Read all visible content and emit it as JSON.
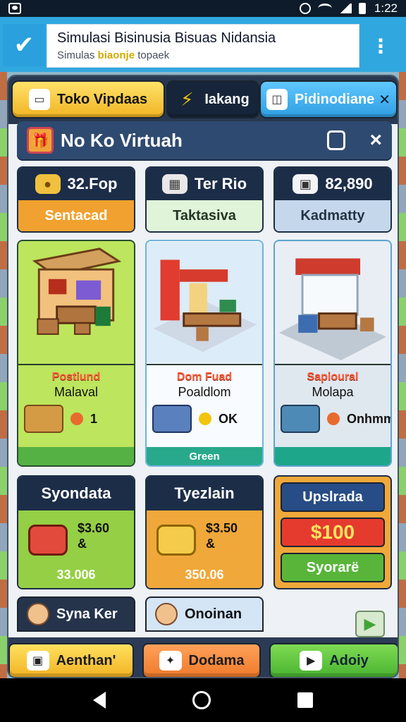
{
  "status_bar": {
    "time": "1:22"
  },
  "browser": {
    "title": "Simulasi Bisinusia Bisuas Nidansia",
    "subtitle_before": "Simulas ",
    "subtitle_highlight": "biaonje",
    "subtitle_after": " topaek"
  },
  "tabs": [
    {
      "label": "Toko Vipdaas"
    },
    {
      "label": "Iakang"
    },
    {
      "label": "Pidinodiane"
    }
  ],
  "subheader": {
    "title": "No Ko Virtuah"
  },
  "info_cards": [
    {
      "top": "32.Fop",
      "bottom": "Sentacad"
    },
    {
      "top": "Ter Rio",
      "bottom": "Taktasiva"
    },
    {
      "top": "82,890",
      "bottom": "Kadmatty"
    }
  ],
  "main_cards": [
    {
      "label1": "Postiund",
      "label2": "Malaval",
      "feature_value": "1",
      "bottom": ""
    },
    {
      "label1": "Dom Fuad",
      "label2": "Poaldlom",
      "feature_value": "OK",
      "bottom": "Green"
    },
    {
      "label1": "Sapioural",
      "label2": "Molapa",
      "feature_value": "Onhmm",
      "bottom": ""
    }
  ],
  "bottom_cards": [
    {
      "head": "Syondata",
      "price_1": "$3.60",
      "price_2": "&",
      "foot": "33.006"
    },
    {
      "head": "Tyezlain",
      "price_1": "$3.50",
      "price_2": "&",
      "foot": "350.06"
    }
  ],
  "upgrade_card": {
    "button_1": "Upslrada",
    "button_2": "$100",
    "button_3": "Syorarë"
  },
  "bottom_row": [
    {
      "label": "Syna Ker"
    },
    {
      "label": "Onoinan"
    }
  ],
  "bottom_nav": [
    {
      "label": "Aenthan'"
    },
    {
      "label": "Dodama"
    },
    {
      "label": "Adoiy"
    }
  ],
  "colors": {
    "accent": "#31a7df",
    "yellow": "#f2b323",
    "orange": "#ee7a2a",
    "green": "#49b431"
  }
}
